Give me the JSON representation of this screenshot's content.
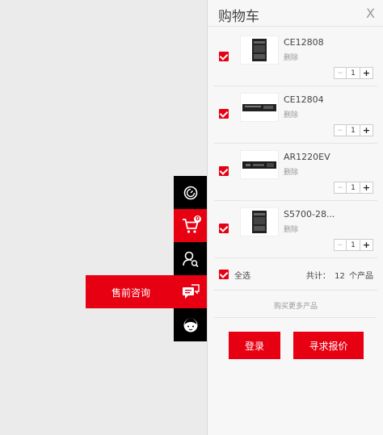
{
  "toolbar": {
    "items": [
      {
        "icon": "clock-icon"
      },
      {
        "icon": "cart-icon",
        "badge": "0"
      },
      {
        "icon": "user-search-icon"
      },
      {
        "icon": "chat-icon",
        "label": "售前咨询"
      },
      {
        "icon": "avatar-icon"
      }
    ]
  },
  "cart": {
    "title": "购物车",
    "close": "X",
    "items": [
      {
        "name": "CE12808",
        "delete": "删除",
        "qty": "1",
        "minus": "−",
        "plus": "+"
      },
      {
        "name": "CE12804",
        "delete": "删除",
        "qty": "1",
        "minus": "−",
        "plus": "+"
      },
      {
        "name": "AR1220EV",
        "delete": "删除",
        "qty": "1",
        "minus": "−",
        "plus": "+"
      },
      {
        "name": "S5700-28...",
        "delete": "删除",
        "qty": "1",
        "minus": "−",
        "plus": "+"
      }
    ],
    "select_all": "全选",
    "total": "共计： 12 个产品",
    "more": "购买更多产品",
    "login": "登录",
    "quote": "寻求报价"
  },
  "colors": {
    "accent": "#e60012",
    "toolbar": "#000000",
    "panel": "#f7f7f7",
    "background": "#ebebeb"
  }
}
